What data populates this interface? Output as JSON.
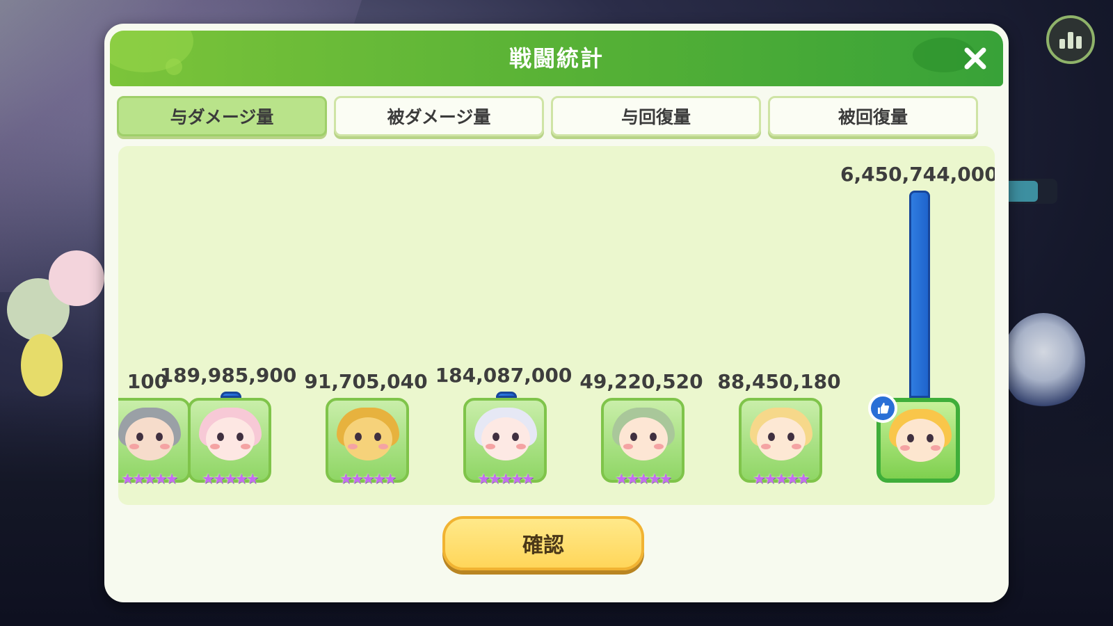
{
  "header": {
    "title": "戦闘統計",
    "close_icon": "close-icon"
  },
  "tabs": [
    {
      "label": "与ダメージ量",
      "active": true
    },
    {
      "label": "被ダメージ量",
      "active": false
    },
    {
      "label": "与回復量",
      "active": false
    },
    {
      "label": "被回復量",
      "active": false
    }
  ],
  "chart_data": {
    "type": "bar",
    "categories": [
      "",
      "",
      "",
      "",
      "",
      "",
      ""
    ],
    "values": [
      null,
      189985900,
      91705040,
      184087000,
      49220520,
      88450180,
      6450744000
    ],
    "value_labels": [
      "100",
      "189,985,900",
      "91,705,040",
      "184,087,000",
      "49,220,520",
      "88,450,180",
      "6,450,744,000"
    ],
    "stars": [
      5,
      5,
      5,
      5,
      5,
      5,
      0
    ],
    "mvp_index": 6,
    "bar_color": "#1f64cc"
  },
  "characters": [
    {
      "name": "partial-character",
      "hair": "#9aa0a6",
      "skin": "#f6dccb"
    },
    {
      "name": "pink-cow-girl",
      "hair": "#f7c9d6",
      "skin": "#fde7e3"
    },
    {
      "name": "bee-sheep",
      "hair": "#e7b23e",
      "skin": "#f6d27a"
    },
    {
      "name": "white-hair-bride",
      "hair": "#e6e8f5",
      "skin": "#fde9e4"
    },
    {
      "name": "green-hair-raincoat",
      "hair": "#a9c79a",
      "skin": "#fde6d4"
    },
    {
      "name": "blonde-bear-hood",
      "hair": "#f6d88a",
      "skin": "#fde8d4"
    },
    {
      "name": "orange-blonde-girl",
      "hair": "#f9c64a",
      "skin": "#fde6cf"
    }
  ],
  "footer": {
    "confirm_label": "確認"
  },
  "background": {
    "stats_icon": "bar-chart-icon"
  }
}
